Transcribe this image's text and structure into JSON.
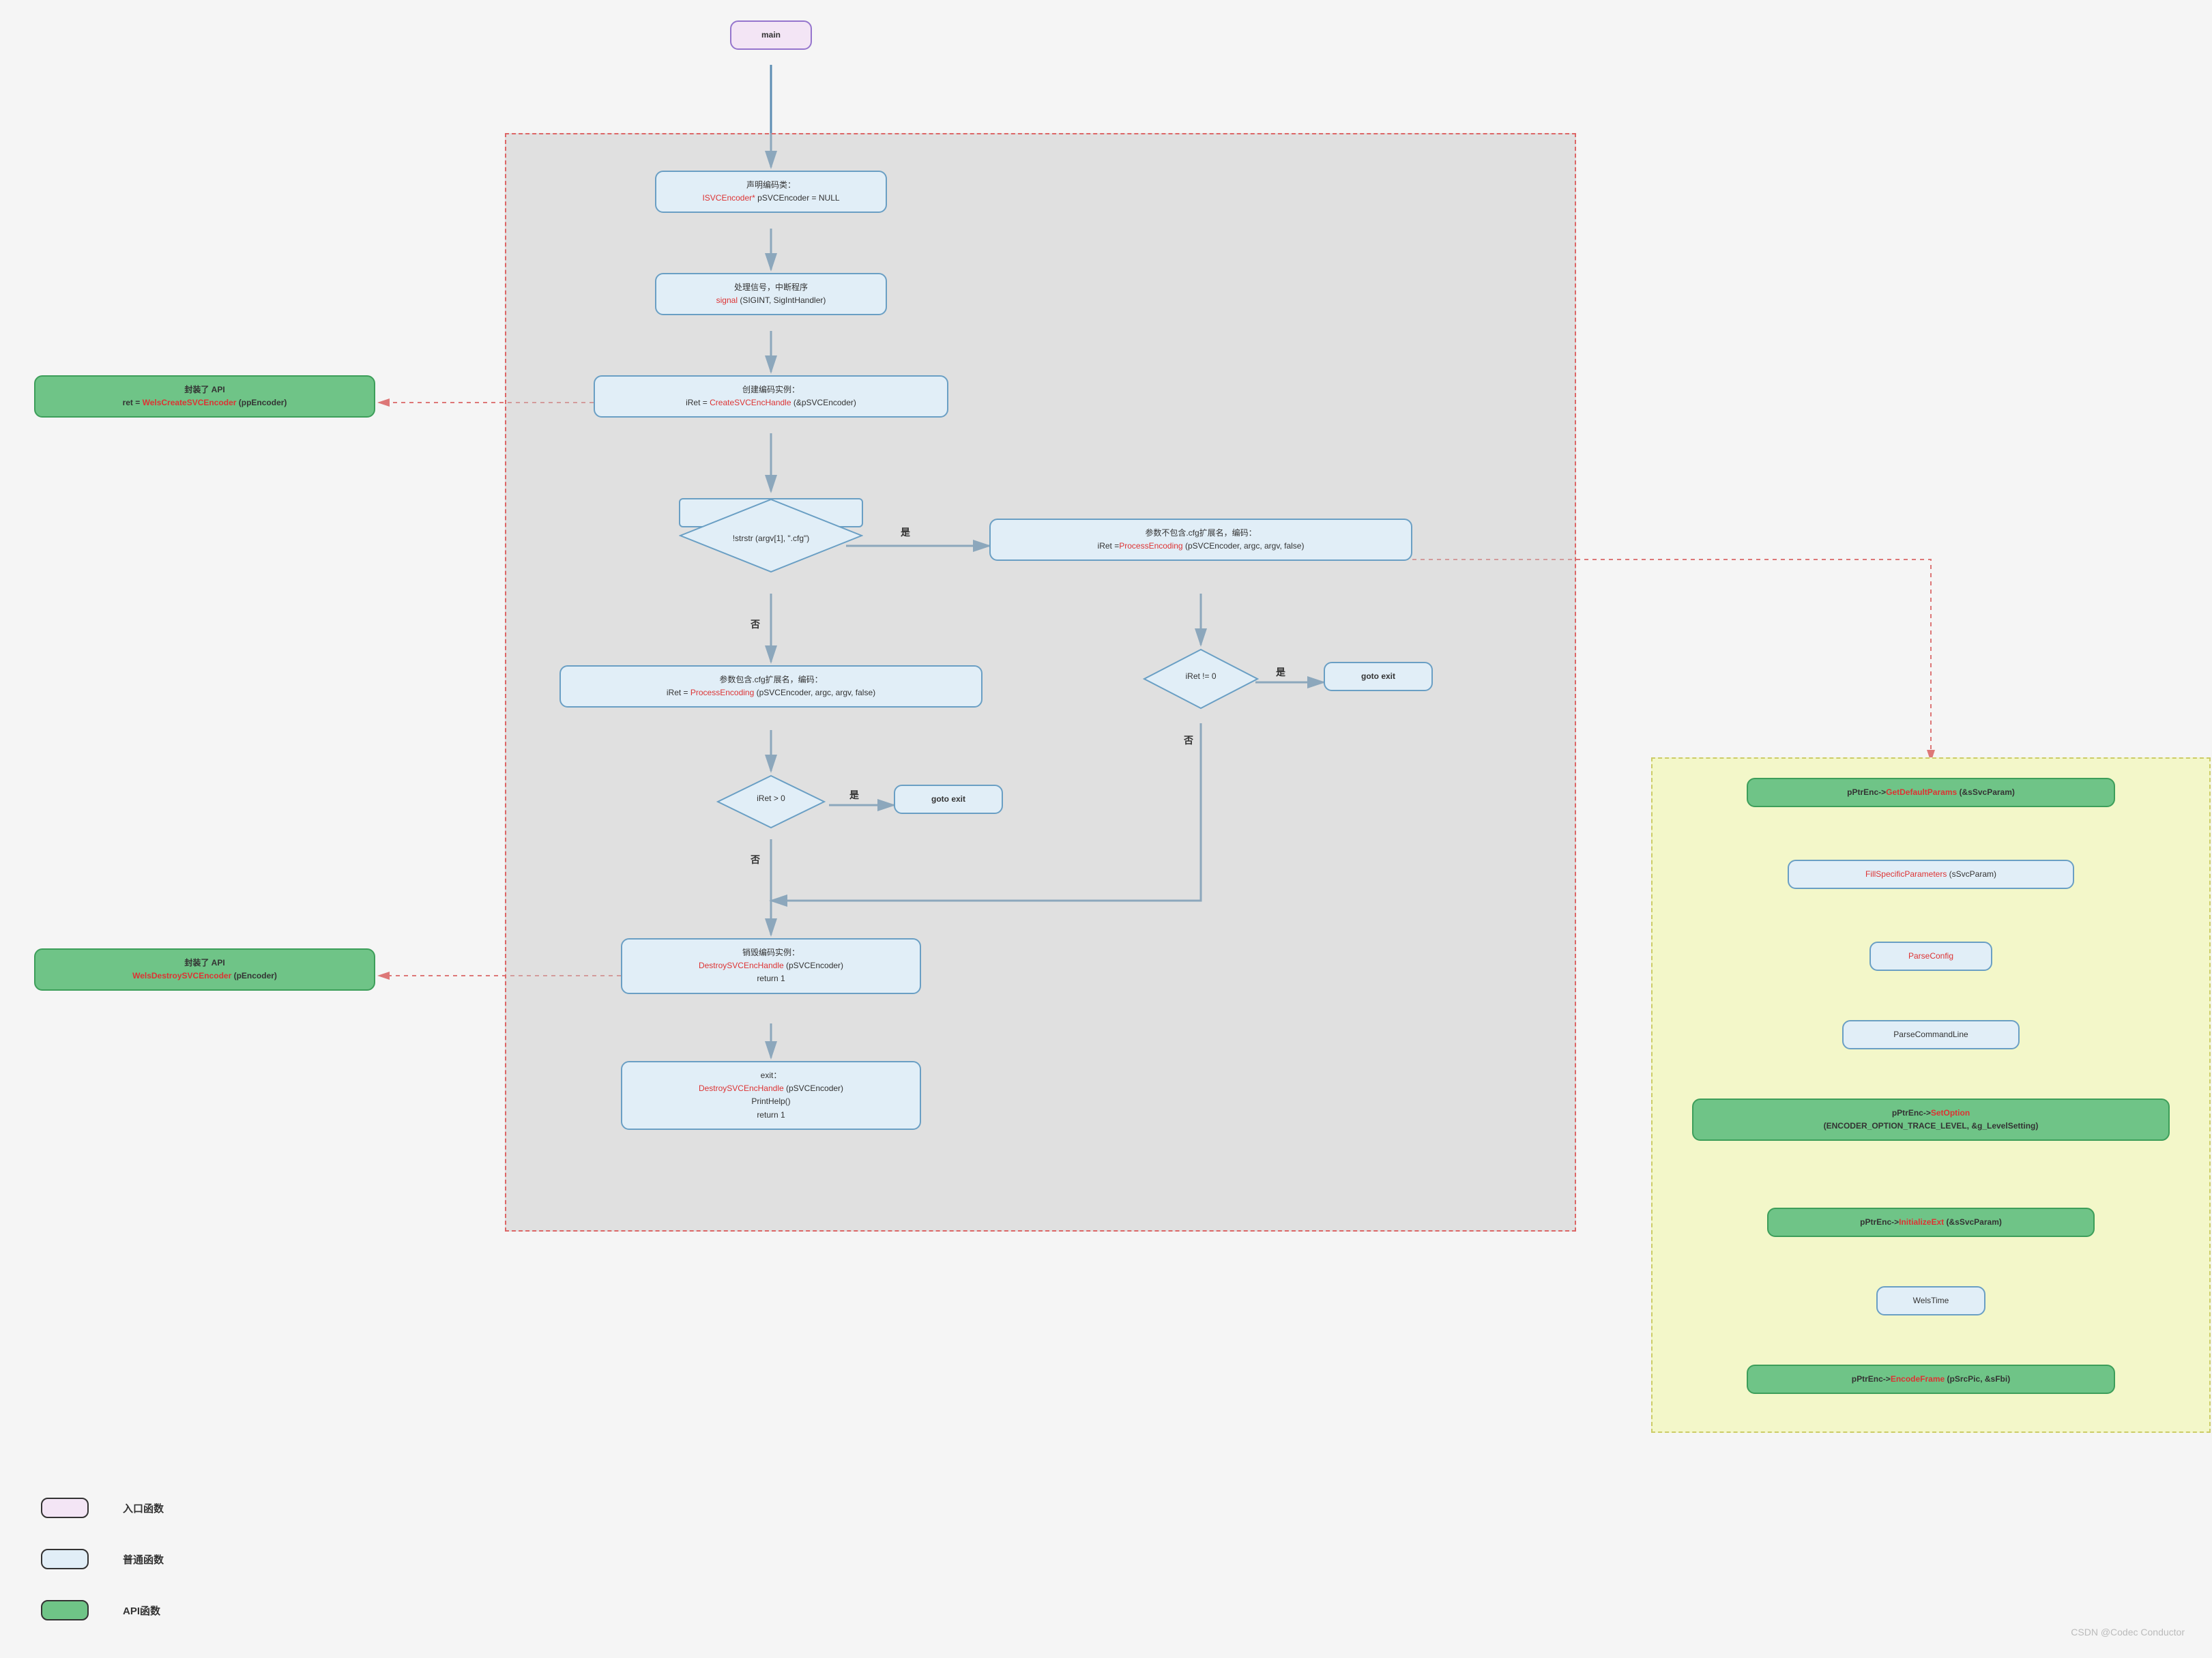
{
  "main": "main",
  "group_gray": {
    "n1_l1": "声明编码类：",
    "n1_l2p": "ISVCEncoder*",
    "n1_l2s": " pSVCEncoder = NULL",
    "n2_l1": "处理信号，中断程序",
    "n2_l2p": "signal",
    "n2_l2s": " (SIGINT, SigIntHandler)",
    "n3_l1": "创建编码实例：",
    "n3_l2a": "iRet = ",
    "n3_l2p": "CreateSVCEncHandle",
    "n3_l2s": " (&pSVCEncoder)",
    "d1": "!strstr (argv[1], \".cfg\")",
    "d1_yes": "是",
    "d1_no": "否",
    "n4_l1": "参数不包含.cfg扩展名，编码：",
    "n4_l2a": "iRet =",
    "n4_l2p": "ProcessEncoding",
    "n4_l2s": " (pSVCEncoder, argc, argv, false)",
    "d2": "iRet != 0",
    "d2_yes": "是",
    "d2_no": "否",
    "goto1": "goto exit",
    "n5_l1": "参数包含.cfg扩展名，编码：",
    "n5_l2a": "iRet = ",
    "n5_l2p": "ProcessEncoding",
    "n5_l2s": " (pSVCEncoder, argc, argv, false)",
    "d3": "iRet > 0",
    "d3_yes": "是",
    "d3_no": "否",
    "goto2": "goto exit",
    "n6_l1": "销毁编码实例：",
    "n6_l2p": "DestroySVCEncHandle",
    "n6_l2s": " (pSVCEncoder)",
    "n6_l3": "return 1",
    "n7_l1": "exit：",
    "n7_l2p": "DestroySVCEncHandle",
    "n7_l2s": " (pSVCEncoder)",
    "n7_l3": "PrintHelp()",
    "n7_l4": "return 1"
  },
  "left": {
    "b1_l1": "封装了 API",
    "b1_l2a": "ret = ",
    "b1_l2p": "WelsCreateSVCEncoder",
    "b1_l2s": " (ppEncoder)",
    "b2_l1": "封装了 API",
    "b2_l2p": "WelsDestroySVCEncoder",
    "b2_l2s": " (pEncoder)"
  },
  "right": {
    "r1a": "pPtrEnc->",
    "r1p": "GetDefaultParams",
    "r1s": " (&sSvcParam)",
    "r2p": "FillSpecificParameters",
    "r2s": " (sSvcParam)",
    "r3": "ParseConfig",
    "r4": "ParseCommandLine",
    "r5a": "pPtrEnc->",
    "r5p": "SetOption",
    "r5b": "(ENCODER_OPTION_TRACE_LEVEL, &g_LevelSetting)",
    "r6a": "pPtrEnc->",
    "r6p": "InitializeExt",
    "r6s": " (&sSvcParam)",
    "r7": "WelsTime",
    "r8a": "pPtrEnc->",
    "r8p": "EncodeFrame",
    "r8s": " (pSrcPic, &sFbi)"
  },
  "legend": {
    "l1": "入口函数",
    "l2": "普通函数",
    "l3": "API函数"
  },
  "watermark": "CSDN @Codec Conductor"
}
